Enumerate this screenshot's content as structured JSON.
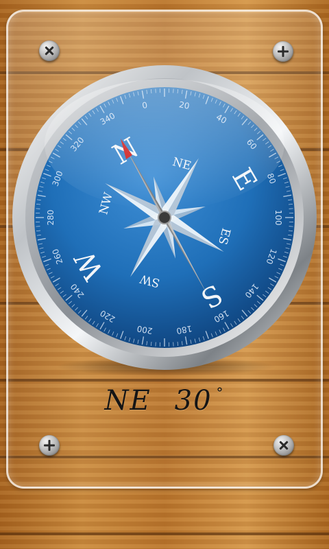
{
  "compass": {
    "cardinals": {
      "north": "N",
      "east": "E",
      "south": "S",
      "west": "W"
    },
    "intercardinals": {
      "ne": "NE",
      "se": "ES",
      "sw": "SW",
      "nw": "NW"
    },
    "degree_labels": [
      "0",
      "20",
      "40",
      "60",
      "80",
      "100",
      "120",
      "140",
      "160",
      "180",
      "200",
      "220",
      "240",
      "260",
      "280",
      "300",
      "320",
      "340"
    ],
    "needle_heading_deg": 330,
    "colors": {
      "dial": "#1f6fb8",
      "needle_north": "#cc1a1a",
      "needle_body": "#9a9a9a",
      "star": "#e8eef5"
    }
  },
  "readout": {
    "direction": "NE",
    "degrees": "30",
    "degree_symbol": "°"
  },
  "icons": {
    "screw_top_left": "screw-x-icon",
    "screw_top_right": "screw-plus-icon",
    "screw_bottom_left": "screw-plus-icon",
    "screw_bottom_right": "screw-x-icon"
  }
}
